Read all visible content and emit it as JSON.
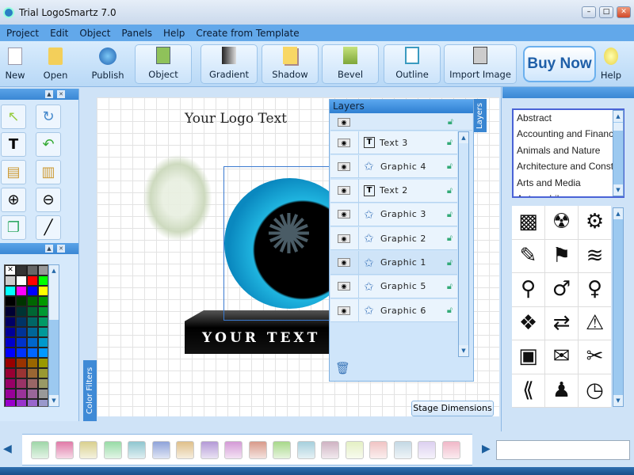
{
  "window": {
    "title": "Trial LogoSmartz 7.0"
  },
  "menu": [
    "Project",
    "Edit",
    "Object",
    "Panels",
    "Help",
    "Create from Template"
  ],
  "toolbar": {
    "new": "New",
    "open": "Open",
    "publish": "Publish",
    "object": "Object",
    "gradient": "Gradient",
    "shadow": "Shadow",
    "bevel": "Bevel",
    "outline": "Outline",
    "import_image": "Import Image",
    "buy_now": "Buy Now",
    "help": "Help"
  },
  "canvas": {
    "logo_text": "Your Logo Text",
    "banner_text": "YOUR TEXT"
  },
  "color_filters_label": "Color Filters",
  "stage_dimensions": "Stage Dimensions",
  "layers": {
    "title": "Layers",
    "tab": "Layers",
    "items": [
      {
        "name": "Text 3",
        "type": "text"
      },
      {
        "name": "Graphic 4",
        "type": "graphic"
      },
      {
        "name": "Text 2",
        "type": "text"
      },
      {
        "name": "Graphic 3",
        "type": "graphic"
      },
      {
        "name": "Graphic 2",
        "type": "graphic"
      },
      {
        "name": "Graphic 1",
        "type": "graphic",
        "selected": true
      },
      {
        "name": "Graphic 5",
        "type": "graphic"
      },
      {
        "name": "Graphic 6",
        "type": "graphic"
      }
    ]
  },
  "categories": [
    "Abstract",
    "Accounting and Finance",
    "Animals and Nature",
    "Architecture and Construction",
    "Arts and Media",
    "Automobiles"
  ],
  "symbols": [
    "▩",
    "☢",
    "⚙",
    "✎",
    "⚑",
    "≋",
    "⚲",
    "♂",
    "♀",
    "❖",
    "⇄",
    "⚠",
    "▣",
    "✉",
    "✂",
    "⟪",
    "♟",
    "◷"
  ],
  "palette": [
    "#ffffff",
    "#333333",
    "#666666",
    "#999999",
    "#cccccc",
    "#ffffff",
    "#ff0000",
    "#00ff00",
    "#00ffff",
    "#ff00ff",
    "#0000ff",
    "#ffff00",
    "#000000",
    "#003300",
    "#006600",
    "#009900",
    "#000033",
    "#003333",
    "#006633",
    "#009933",
    "#000066",
    "#003366",
    "#006666",
    "#009966",
    "#000099",
    "#003399",
    "#006699",
    "#009999",
    "#0000cc",
    "#0033cc",
    "#0066cc",
    "#0099cc",
    "#0000ff",
    "#0033ff",
    "#0066ff",
    "#0099ff",
    "#990000",
    "#993300",
    "#996600",
    "#999900",
    "#990033",
    "#993333",
    "#996633",
    "#999933",
    "#990066",
    "#993366",
    "#996666",
    "#999966",
    "#990099",
    "#993399",
    "#996699",
    "#999999",
    "#9900cc",
    "#9933cc",
    "#9966cc",
    "#9999cc",
    "#9900ff",
    "#9933ff",
    "#9966ff",
    "#9999ff"
  ],
  "swatches": [
    "#9fd6a8",
    "#e07aa8",
    "#d9d08e",
    "#98dba6",
    "#8fc6cf",
    "#8fa3d9",
    "#dfc08a",
    "#b49ad6",
    "#d49ad6",
    "#d89a8a",
    "#a8d88a",
    "#a6cfdc",
    "#cfb3c3",
    "#e4f0c4",
    "#f0c4c4",
    "#c4d8e4",
    "#dcd0f0",
    "#f0b8c8"
  ],
  "accent": "#3a87d4"
}
